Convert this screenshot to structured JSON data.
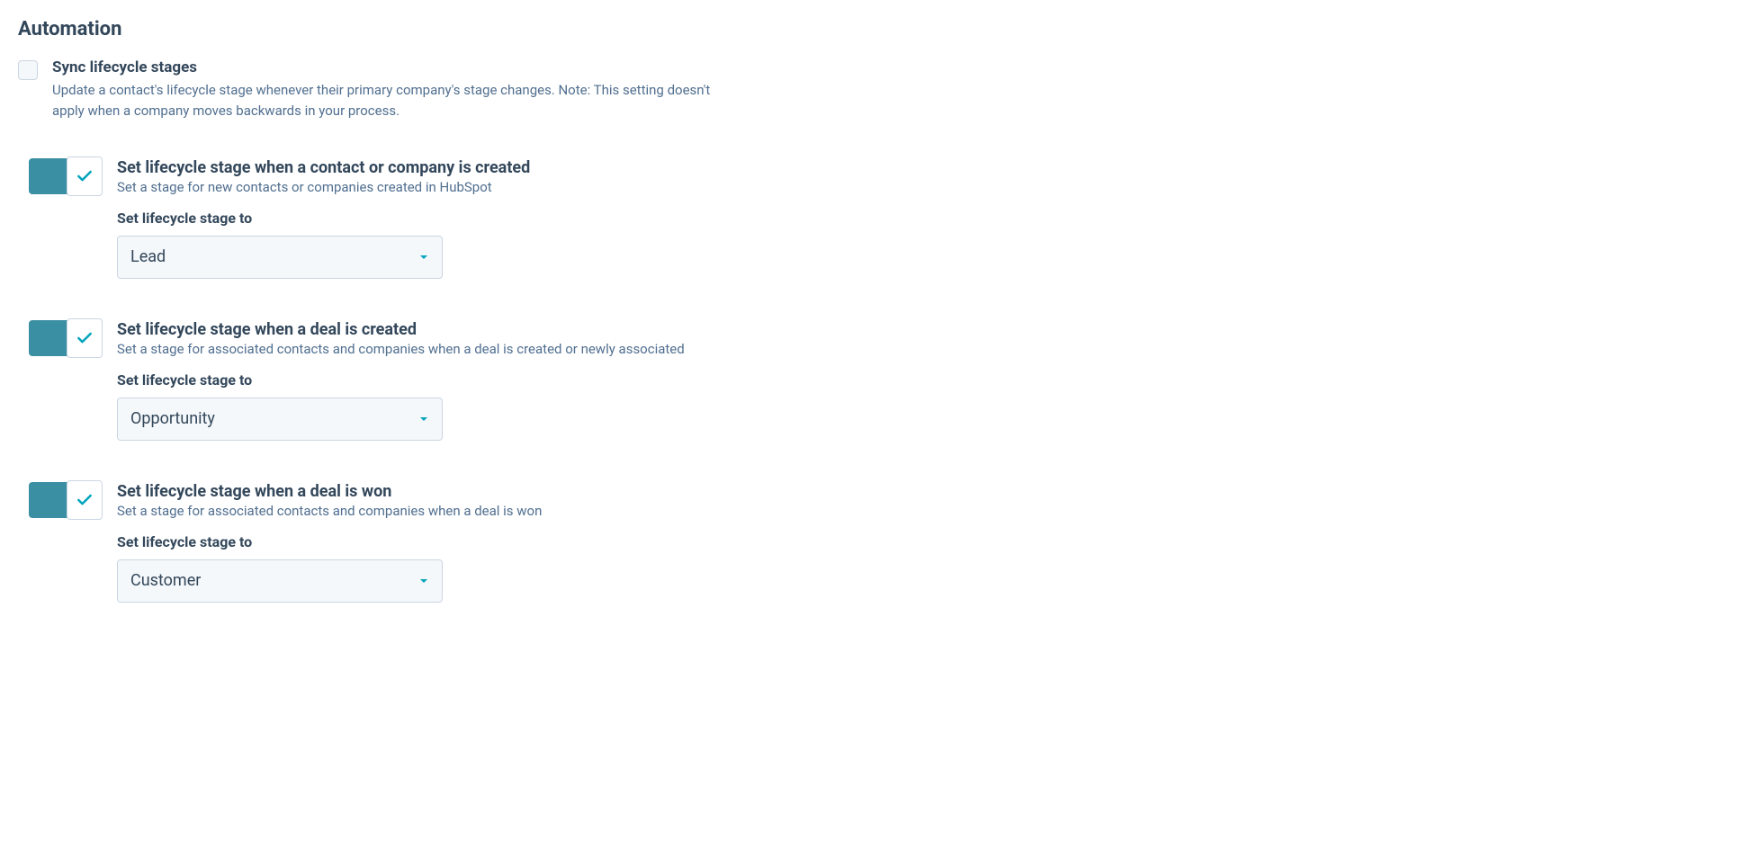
{
  "heading": "Automation",
  "sync": {
    "title": "Sync lifecycle stages",
    "desc": "Update a contact's lifecycle stage whenever their primary company's stage changes. Note: This setting doesn't apply when a company moves backwards in your process."
  },
  "blocks": [
    {
      "title": "Set lifecycle stage when a contact or company is created",
      "desc": "Set a stage for new contacts or companies created in HubSpot",
      "select_label": "Set lifecycle stage to",
      "select_value": "Lead"
    },
    {
      "title": "Set lifecycle stage when a deal is created",
      "desc": "Set a stage for associated contacts and companies when a deal is created or newly associated",
      "select_label": "Set lifecycle stage to",
      "select_value": "Opportunity"
    },
    {
      "title": "Set lifecycle stage when a deal is won",
      "desc": "Set a stage for associated contacts and companies when a deal is won",
      "select_label": "Set lifecycle stage to",
      "select_value": "Customer"
    }
  ],
  "colors": {
    "accent": "#00a4bd",
    "toggle_bg": "#3b8fa3",
    "heading": "#33475b",
    "muted": "#516f90",
    "border": "#cbd6e2",
    "panel_bg": "#f5f8fa"
  }
}
